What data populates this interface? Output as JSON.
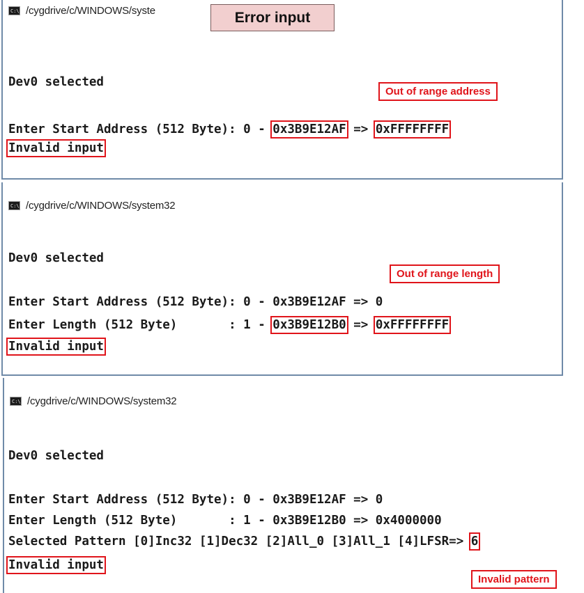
{
  "badge": {
    "label": "Error input"
  },
  "panel1": {
    "title": "/cygdrive/c/WINDOWS/syste",
    "line_dev": "Dev0 selected",
    "callout": "Out of range address",
    "addr_prefix": "Enter Start Address (512 Byte): 0 - ",
    "addr_max": "0x3B9E12AF",
    "arrow": " => ",
    "addr_value": "0xFFFFFFFF",
    "result": "Invalid input"
  },
  "panel2": {
    "title": "/cygdrive/c/WINDOWS/system32",
    "line_dev": "Dev0 selected",
    "callout": "Out of range length",
    "addr_line": "Enter Start Address (512 Byte): 0 - 0x3B9E12AF => 0",
    "len_prefix": "Enter Length (512 Byte)       : 1 - ",
    "len_max": "0x3B9E12B0",
    "arrow": " => ",
    "len_value": "0xFFFFFFFF",
    "result": "Invalid input"
  },
  "panel3": {
    "title": "/cygdrive/c/WINDOWS/system32",
    "line_dev": "Dev0 selected",
    "addr_line": "Enter Start Address (512 Byte): 0 - 0x3B9E12AF => 0",
    "len_line": "Enter Length (512 Byte)       : 1 - 0x3B9E12B0 => 0x4000000",
    "pattern_prefix": "Selected Pattern [0]Inc32 [1]Dec32 [2]All_0 [3]All_1 [4]LFSR=> ",
    "pattern_value": "6",
    "result": "Invalid input",
    "callout": "Invalid pattern"
  },
  "colors": {
    "highlight": "#e0141a",
    "badge_bg": "#f2cfcf",
    "frame": "#6f8aa8"
  }
}
